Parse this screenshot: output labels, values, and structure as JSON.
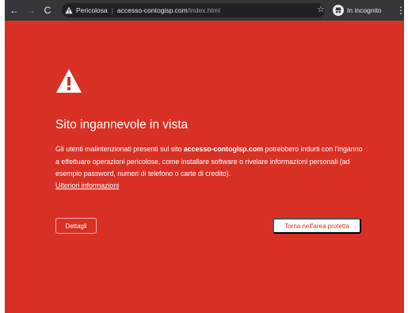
{
  "browser": {
    "back_glyph": "←",
    "forward_glyph": "→",
    "reload_glyph": "C",
    "security_label": "Pericolosa",
    "separator": "|",
    "url_host": "accesso-contogisp.com",
    "url_path": "/index.html",
    "bookmark_glyph": "☆",
    "incognito_label": "In incognito",
    "menu_glyph": "⋮",
    "icons": {
      "back": "arrow-left-icon",
      "forward": "arrow-right-icon",
      "reload": "reload-icon",
      "security": "warning-triangle-icon",
      "bookmark": "star-icon",
      "incognito": "incognito-icon",
      "menu": "kebab-menu-icon"
    }
  },
  "warning": {
    "icon": "danger-triangle-icon",
    "title": "Sito ingannevole in vista",
    "body_before": "Gli utenti malintenzionati presenti sul sito ",
    "body_site": "accesso-contogisp.com",
    "body_after": " potrebbero indurti con l'inganno a effettuare operazioni pericolose, come installare software o rivelare informazioni personali (ad esempio password, numeri di telefono o carte di credito).",
    "learn_more": "Ulteriori informazioni",
    "details_button": "Dettagli",
    "back_button": "Torna nell'area protetta"
  },
  "colors": {
    "danger_background": "#d93025",
    "toolbar": "#35363a",
    "omnibox": "#202124",
    "text_on_danger": "#ffffff"
  }
}
